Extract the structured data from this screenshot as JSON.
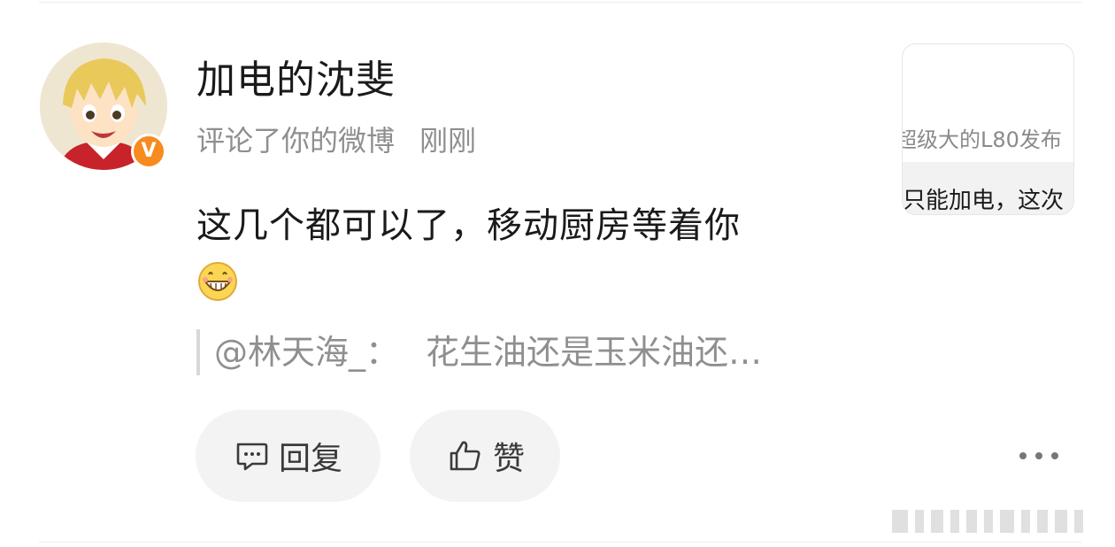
{
  "notification": {
    "username": "加电的沈斐",
    "action": "评论了你的微博",
    "time": "刚刚",
    "comment": "这几个都可以了，移动厨房等着你",
    "emoji_icon": "grin-emoji-icon",
    "quote": {
      "mention": "@林天海_",
      "separator": "：",
      "excerpt": "花生油还是玉米油还…"
    },
    "actions": {
      "reply_label": "回复",
      "like_label": "赞"
    },
    "thumbnail": {
      "line1": "超级大的L80发布",
      "line2": "只能加电，这次"
    },
    "badge": "V"
  },
  "colors": {
    "badge": "#f78b1f",
    "muted_text": "#8f8f8f",
    "pill_bg": "#f3f3f3"
  }
}
